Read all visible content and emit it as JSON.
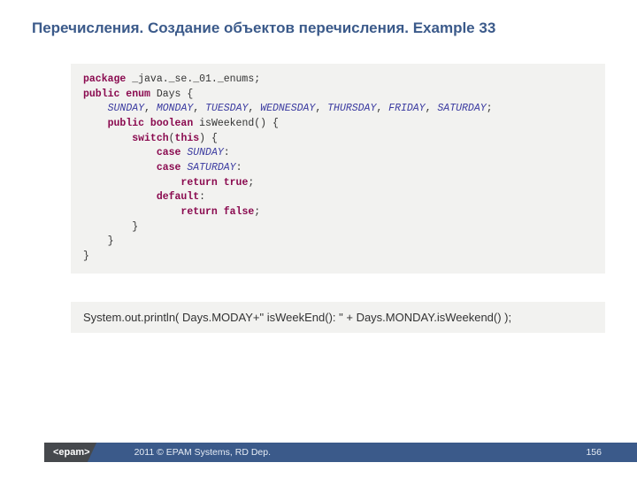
{
  "title": "Перечисления. Создание объектов перечисления. Example 33",
  "code": {
    "package_kw": "package",
    "package_name": " _java._se._01._enums;",
    "public_enum": "public enum ",
    "enum_name": "Days",
    "brace_open": " {",
    "sunday": "SUNDAY",
    "monday": "MONDAY",
    "tuesday": "TUESDAY",
    "wednesday": "WEDNESDAY",
    "thursday": "THURSDAY",
    "friday": "FRIDAY",
    "saturday": "SATURDAY",
    "comma": ", ",
    "semicolon": ";",
    "method_sig": "public boolean ",
    "method_name": "isWeekend",
    "method_after": "() {",
    "switch_kw": "switch",
    "switch_arg": "(",
    "this_kw": "this",
    "switch_arg_close": ") {",
    "case_kw": "case ",
    "colon": ":",
    "return_kw": "return ",
    "true_kw": "true",
    "false_kw": "false",
    "default_kw": "default",
    "brace_close": "}"
  },
  "call_line": "System.out.println( Days.MODAY+\" isWeekEnd(): \" + Days.MONDAY.isWeekend() );",
  "footer": {
    "logo": "<epam>",
    "copyright": "2011 © EPAM Systems, RD Dep.",
    "page": "156"
  }
}
